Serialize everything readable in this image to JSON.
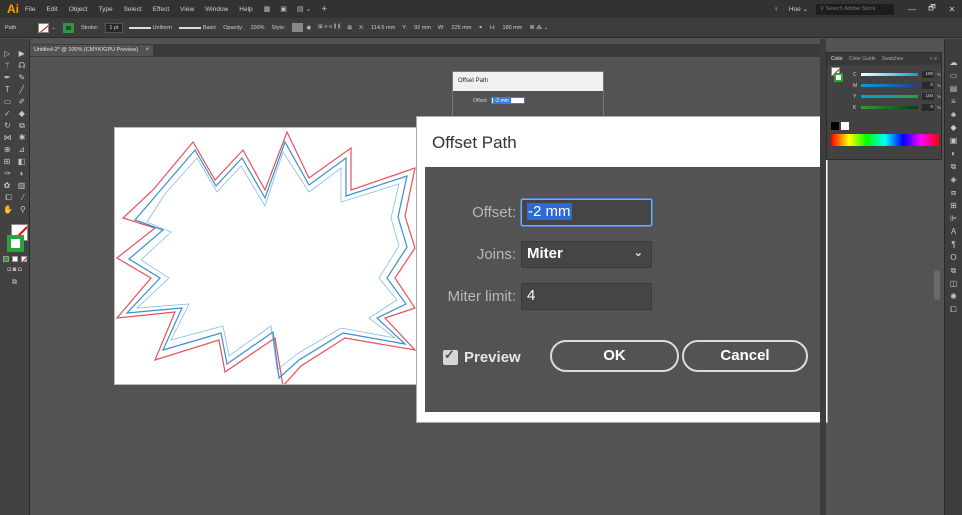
{
  "menubar": {
    "logo": "Ai",
    "items": [
      "File",
      "Edit",
      "Object",
      "Type",
      "Select",
      "Effect",
      "View",
      "Window",
      "Help"
    ],
    "workspace": "Hoe ⌄",
    "search_placeholder": "Search Adobe Stock",
    "window_buttons": [
      "—",
      "🗗",
      "✕"
    ]
  },
  "controlbar": {
    "selection": "Path",
    "stroke_label": "Stroke:",
    "stroke_value": "1 pt",
    "profile": "Uniform",
    "brush": "Basic",
    "opacity_label": "Opacity:",
    "opacity_value": "100%",
    "style_label": "Style:",
    "x_label": "X:",
    "x_value": "114.5 mm",
    "y_label": "Y:",
    "y_value": "92 mm",
    "w_label": "W:",
    "w_value": "225 mm",
    "h_label": "H:",
    "h_value": "180 mm"
  },
  "document": {
    "tab_title": "Untitled-2* @ 100% (CMYK/GPU Preview)",
    "close": "×"
  },
  "small_dialog": {
    "title": "Offset Path",
    "offset_label": "Offset:",
    "offset_value": "-2 mm"
  },
  "dialog": {
    "title": "Offset Path",
    "offset_label": "Offset:",
    "offset_value": "-2 mm",
    "joins_label": "Joins:",
    "joins_value": "Miter",
    "miter_label": "Miter limit:",
    "miter_value": "4",
    "preview_label": "Preview",
    "preview_checked": true,
    "ok_label": "OK",
    "cancel_label": "Cancel"
  },
  "color_panel": {
    "tabs": [
      "Color",
      "Color Guide",
      "Swatches"
    ],
    "channels": [
      {
        "name": "C",
        "value": "100",
        "unit": "%"
      },
      {
        "name": "M",
        "value": "0",
        "unit": "%"
      },
      {
        "name": "Y",
        "value": "100",
        "unit": "%"
      },
      {
        "name": "K",
        "value": "0",
        "unit": "%"
      }
    ]
  },
  "colors": {
    "accent_orange": "#ff9a00",
    "stroke_green": "#29a33a",
    "shape_red": "#e8505b",
    "shape_blue": "#3a8fd0",
    "focus_blue": "#2a6bd6"
  }
}
